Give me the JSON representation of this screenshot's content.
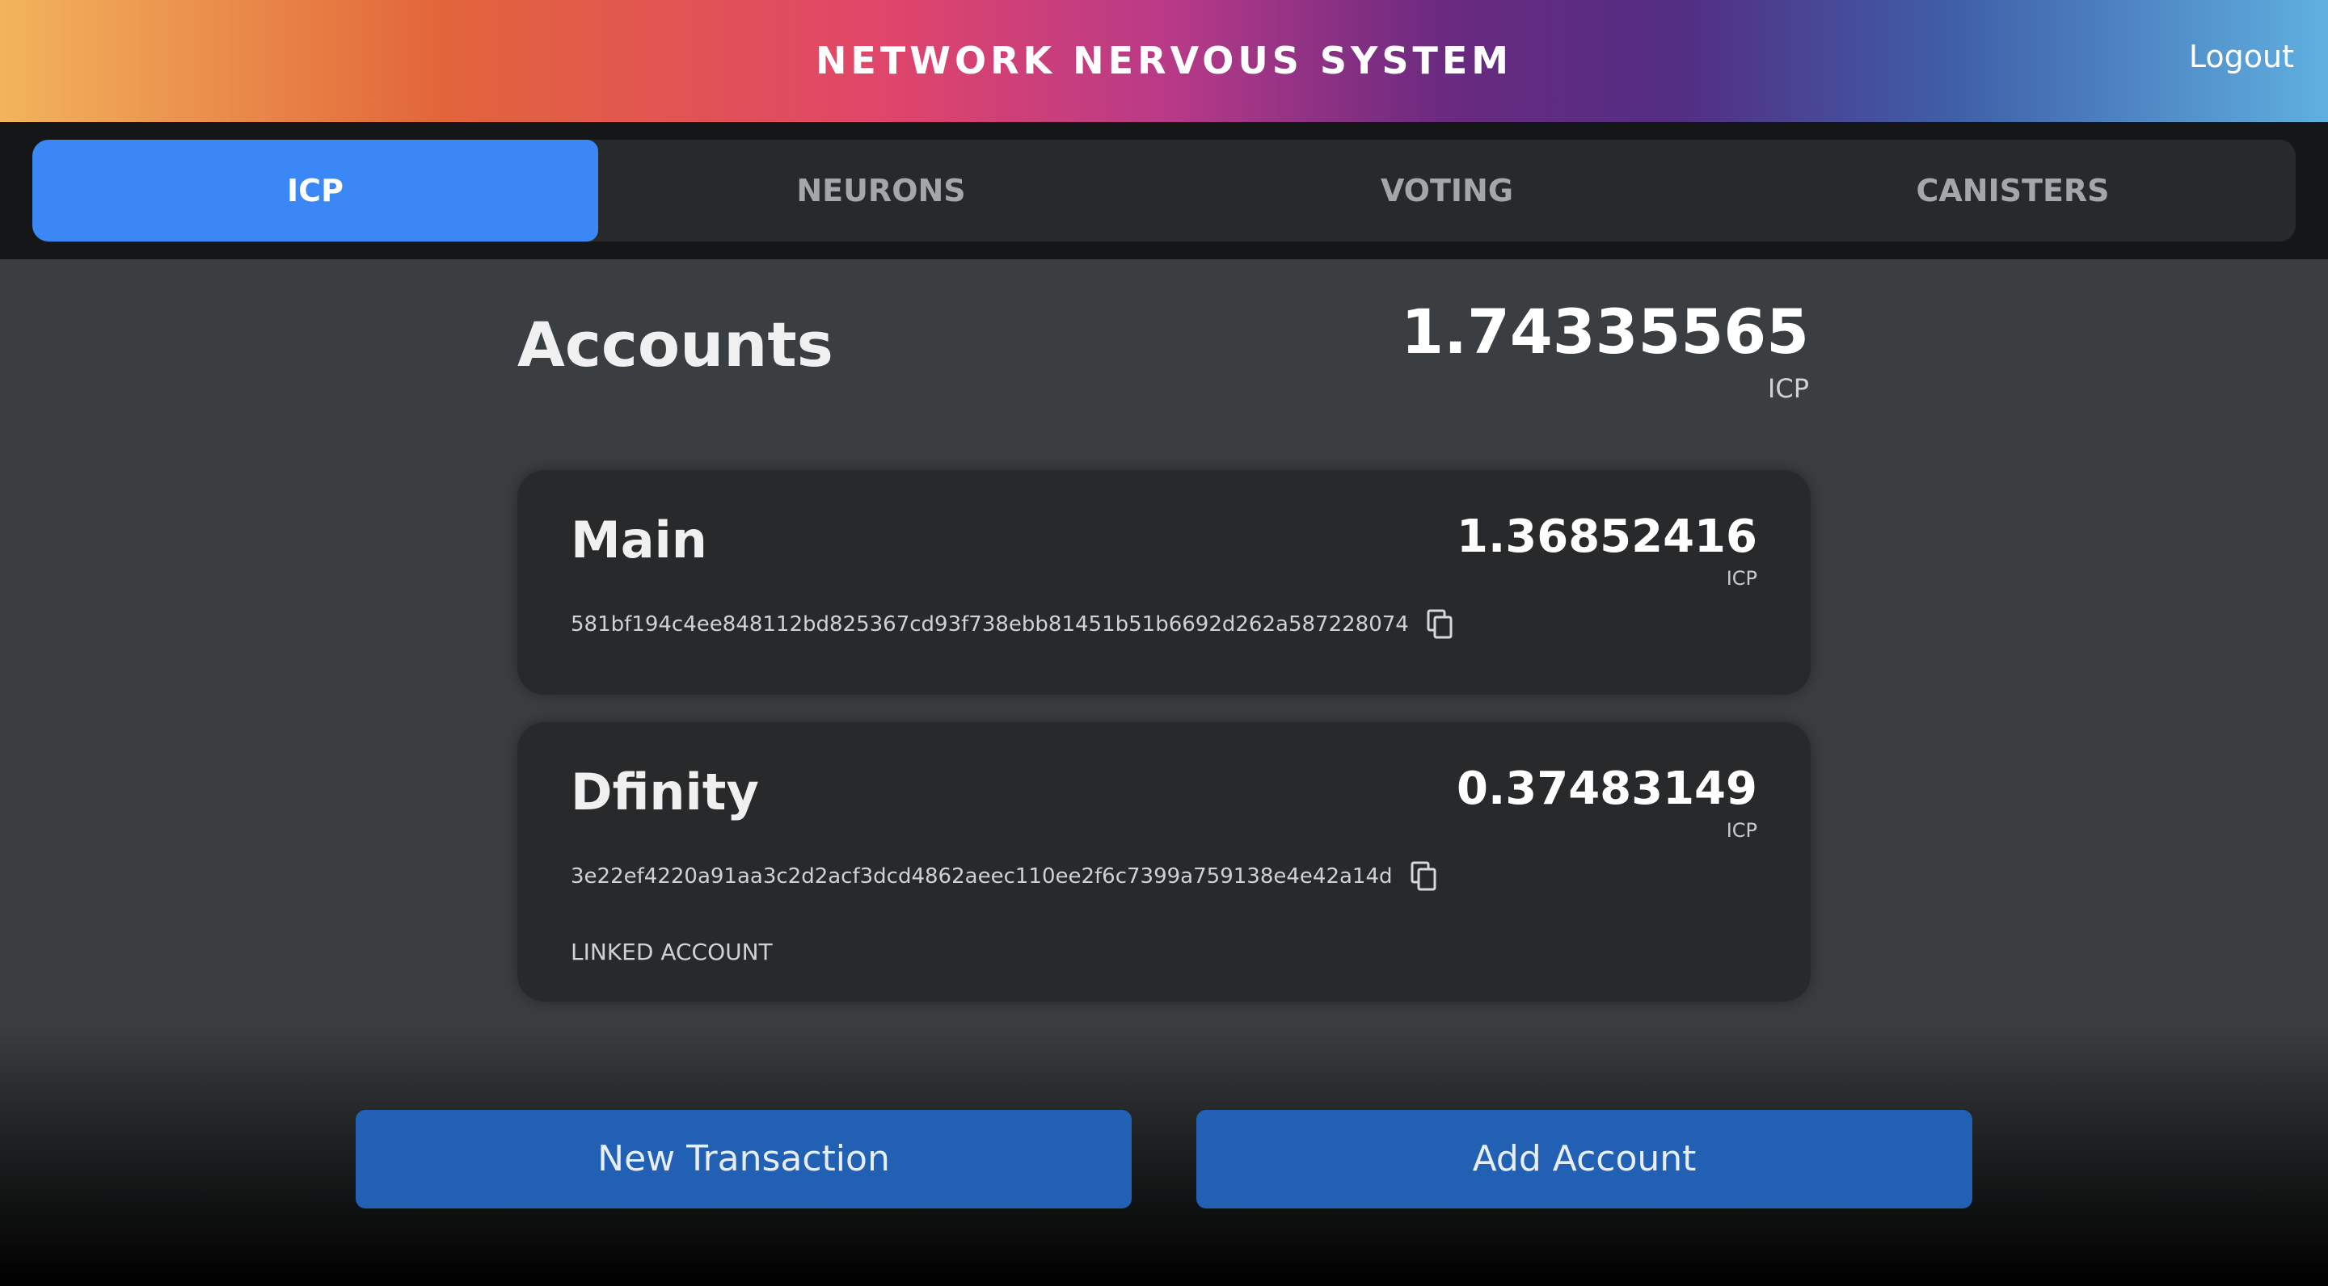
{
  "header": {
    "title": "NETWORK NERVOUS SYSTEM",
    "logout_label": "Logout"
  },
  "tabs": [
    {
      "label": "ICP",
      "active": true
    },
    {
      "label": "NEURONS",
      "active": false
    },
    {
      "label": "VOTING",
      "active": false
    },
    {
      "label": "CANISTERS",
      "active": false
    }
  ],
  "accounts": {
    "title": "Accounts",
    "total_balance": "1.74335565",
    "total_unit": "ICP",
    "items": [
      {
        "name": "Main",
        "balance": "1.36852416",
        "unit": "ICP",
        "address": "581bf194c4ee848112bd825367cd93f738ebb81451b51b6692d262a587228074"
      },
      {
        "name": "Dfinity",
        "balance": "0.37483149",
        "unit": "ICP",
        "address": "3e22ef4220a91aa3c2d2acf3dcd4862aeec110ee2f6c7399a759138e4e42a14d",
        "tag": "LINKED ACCOUNT"
      }
    ]
  },
  "actions": {
    "new_transaction_label": "New Transaction",
    "add_account_label": "Add Account"
  },
  "colors": {
    "active_tab": "#3a87f5",
    "button": "#2260b3",
    "card": "#27292a",
    "background": "#3a3e41"
  }
}
